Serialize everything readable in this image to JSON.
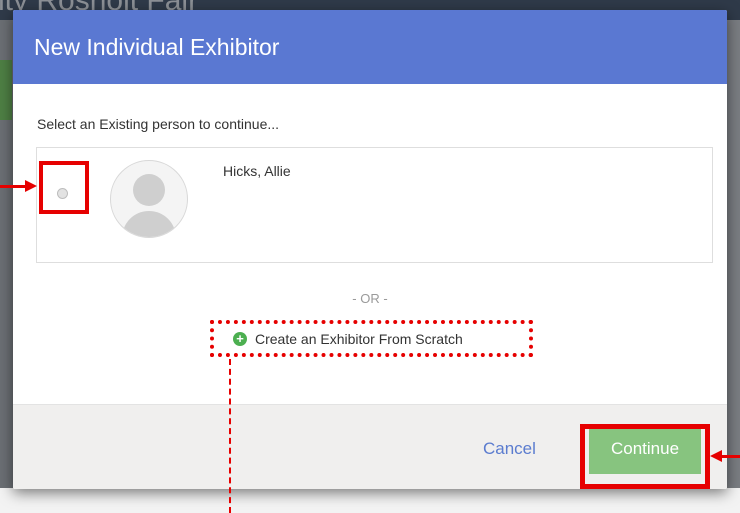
{
  "background": {
    "page_title": "nty Rosholt Fair"
  },
  "modal": {
    "title": "New Individual Exhibitor",
    "prompt": "Select an Existing person to continue...",
    "person": {
      "name": "Hicks, Allie",
      "selected": false
    },
    "or_text": "- OR -",
    "create_link_label": "Create an Exhibitor From Scratch",
    "cancel_label": "Cancel",
    "continue_label": "Continue"
  },
  "colors": {
    "header": "#5a78d2",
    "continue": "#87c47f",
    "cancel_link": "#5b7ccf",
    "annotation": "#e60000"
  },
  "icons": {
    "avatar": "user-placeholder-icon",
    "create": "plus-circle-icon",
    "radio": "radio-button-icon"
  }
}
